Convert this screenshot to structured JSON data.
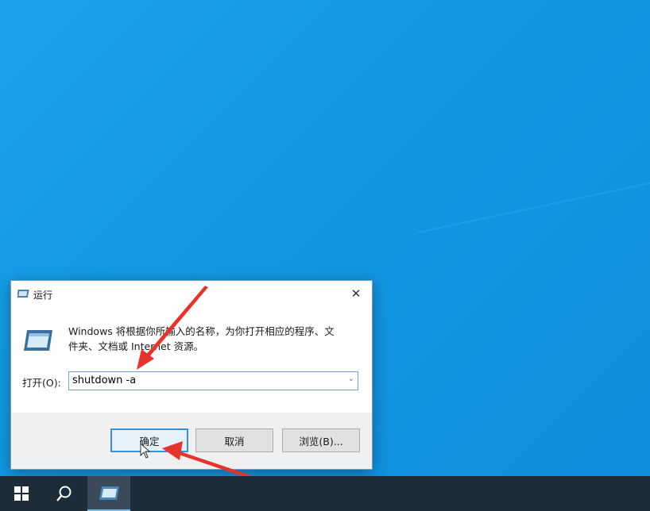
{
  "dialog": {
    "title": "运行",
    "icon": "run-icon",
    "close_icon": "close-icon",
    "description_line1": "Windows 将根据你所输入的名称，为你打开相应的程序、文",
    "description_line2": "件夹、文档或 Internet 资源。",
    "open_label": "打开(O):",
    "open_value": "shutdown -a",
    "ok_label": "确定",
    "cancel_label": "取消",
    "browse_label": "浏览(B)..."
  },
  "taskbar": {
    "start_icon": "windows-logo-icon",
    "search_icon": "search-icon",
    "run_task_icon": "run-icon"
  },
  "colors": {
    "desktop": "#1297e3",
    "annotation_arrow": "#e8322c",
    "taskbar": "#1c2c38"
  }
}
